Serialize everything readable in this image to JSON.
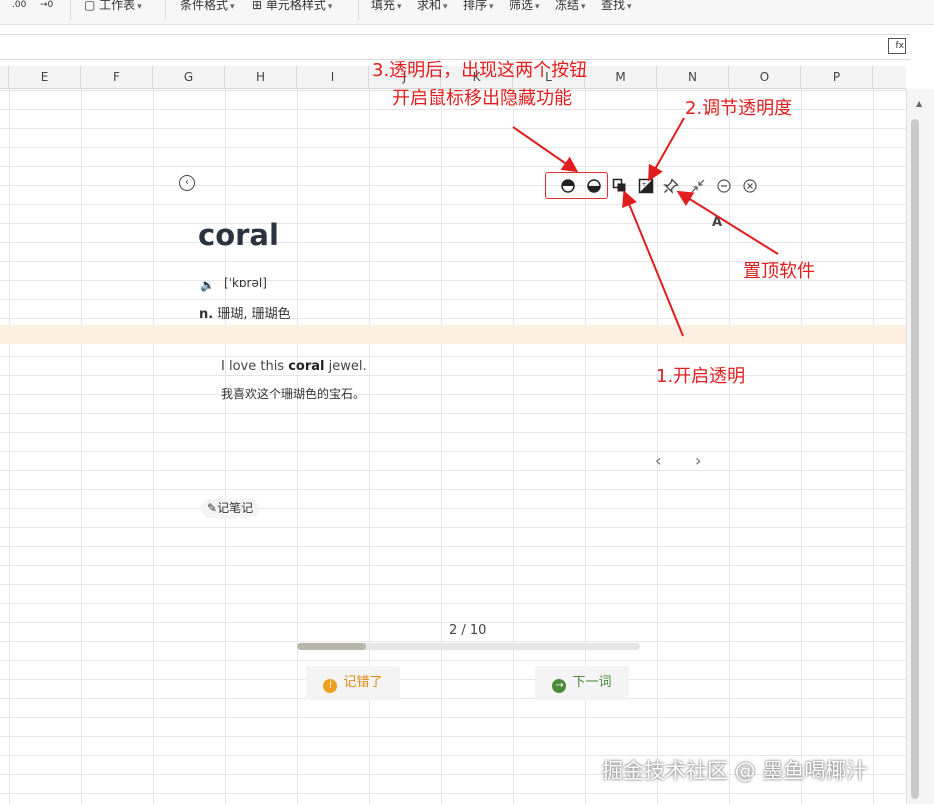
{
  "ribbon": {
    "worksheet": "工作表",
    "conditional_format": "条件格式",
    "cell_style": "单元格样式",
    "fill": "填充",
    "sum": "求和",
    "sort": "排序",
    "filter": "筛选",
    "freeze": "冻结",
    "find": "查找",
    "small_left_1": ".00",
    "small_left_2": "→0"
  },
  "formula_bar": {
    "fx_label": "fx"
  },
  "columns": [
    "E",
    "F",
    "G",
    "H",
    "I",
    "J",
    "K",
    "L",
    "M",
    "N",
    "O",
    "P"
  ],
  "app": {
    "word": "coral",
    "phonetic": "[ˈkɒrəl]",
    "definition_pos": "n.",
    "definition_text": "珊瑚, 珊瑚色",
    "example_en_prefix": "I love this ",
    "example_en_word": "coral",
    "example_en_suffix": " jewel.",
    "example_zh": "我喜欢这个珊瑚色的宝石。",
    "note_button": "记笔记",
    "counter": "2 / 10",
    "progress_fraction": 0.2,
    "wrong_button": "记错了",
    "next_button": "下一词",
    "ac_text": "A"
  },
  "annotations": {
    "step3_line1": "3.透明后，出现这两个按钮",
    "step3_line2": "开启鼠标移出隐藏功能",
    "step2": "2.调节透明度",
    "pin": "置顶软件",
    "step1": "1.开启透明"
  },
  "watermark": "掘金技术社区 @ 墨鱼喝椰汁",
  "colors": {
    "annotation_red": "#e11d1d",
    "wrong_orange": "#f0a020",
    "next_green": "#4a8a3a",
    "highlight_row": "#fdf0e2"
  }
}
